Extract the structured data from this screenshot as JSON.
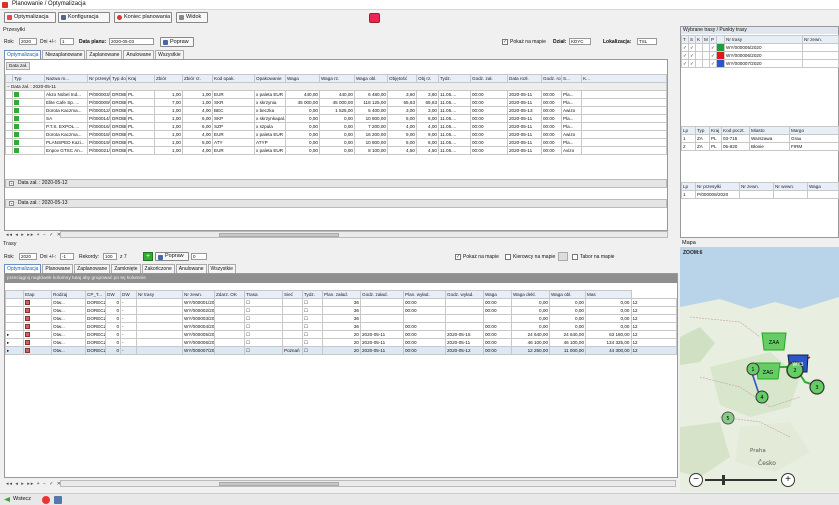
{
  "window": {
    "title": "Planowanie / Optymalizacja"
  },
  "toolbar": {
    "optimization": "Optymalizacja",
    "configuration": "Konfiguracja",
    "end_planning": "Koniec planowania",
    "view": "Widok"
  },
  "przesylki": {
    "title": "Przesyłki",
    "rok_label": "Rok:",
    "rok_value": "2020",
    "dni_label": "Dni +/-:",
    "dni_value": "1",
    "data_planu_label": "Data planu:",
    "data_planu_value": "2020-05-03",
    "popraw": "Popraw",
    "show_on_map": "Pokaż na mapie",
    "dzial_label": "Dział:",
    "dzial_value": "KDYC",
    "lokalizacja_label": "Lokalizacja:",
    "lokalizacja_value": "TSL",
    "tabs": [
      "Optymalizacja",
      "Niezaplanowane",
      "Zaplanowane",
      "Anulowane",
      "Wszystkie"
    ],
    "group_chip": "Data zał.",
    "columns": [
      "Typ",
      "Nazwa m...",
      "Nr przesyłki",
      "Typ doc.",
      "Kraj",
      "Zbiór",
      "Zbiór rz.",
      "Kod opak.",
      "Opakowanie",
      "Waga",
      "Waga rz.",
      "Waga obl.",
      "Objętość",
      "Obj rz.",
      "Tydz.",
      "Godz. zał.",
      "Data rozł.",
      "Godz. rozł.",
      "S...",
      "K..."
    ],
    "groups": [
      "Data zał. : 2020-05-11",
      "Data zał. : 2020-05-12",
      "Data zał. : 2020-05-13"
    ],
    "rows": [
      [
        "Akzo Nobel Ind...",
        "P/000003/2020",
        "DROBN",
        "PL",
        "1,00",
        "1,00",
        "EUR",
        "x paleta EUR",
        "440,00",
        "440,00",
        "6 480,00",
        "3,60",
        "3,60",
        "11.05....",
        "00:00",
        "2020-05-11",
        "00:00",
        "Pla..."
      ],
      [
        "Elite Cafe Sp. ...",
        "P/000009/2020",
        "DROBN",
        "PL",
        "7,00",
        "1,00",
        "SKR",
        "x skrzynia",
        "45 000,00",
        "45 000,00",
        "118 125,00",
        "65,63",
        "65,63",
        "11.05....",
        "00:00",
        "2020-05-11",
        "00:00",
        "Pla..."
      ],
      [
        "Dorota Kaczma...",
        "P/000012/2020",
        "DROBN",
        "PL",
        "1,00",
        "4,00",
        "BEC",
        "x beczka",
        "0,00",
        "1 525,00",
        "5 400,00",
        "3,00",
        "3,00",
        "11.05....",
        "00:00",
        "2020-05-13",
        "00:00",
        "Awizo"
      ],
      [
        "SA",
        "P/000014/2020",
        "DROBN",
        "PL",
        "1,00",
        "6,00",
        "SKP",
        "x skrzynkapal...",
        "0,00",
        "0,00",
        "10 800,00",
        "6,00",
        "6,00",
        "11.05....",
        "00:00",
        "2020-05-11",
        "00:00",
        "Pla..."
      ],
      [
        "P.T.S. EXPOL ...",
        "P/000016/2020",
        "DROBN",
        "PL",
        "1,00",
        "6,00",
        "SZP",
        "x szpula",
        "0,00",
        "0,00",
        "7 200,00",
        "4,00",
        "4,00",
        "11.05....",
        "00:00",
        "2020-05-11",
        "00:00",
        "Pla..."
      ],
      [
        "Dorota Kaczma...",
        "P/000018/2020",
        "DROBN",
        "PL",
        "1,00",
        "4,00",
        "EUR",
        "x paleta EUR",
        "0,00",
        "0,00",
        "16 200,00",
        "9,00",
        "9,00",
        "11.05....",
        "00:00",
        "2020-05-11",
        "00:00",
        "Awizo"
      ],
      [
        "PLANSPED Kazi...",
        "P/000019/2020",
        "DROBN",
        "PL",
        "1,00",
        "5,00",
        "ATY",
        "ATYP",
        "0,00",
        "0,00",
        "10 800,00",
        "6,00",
        "6,00",
        "11.05....",
        "00:00",
        "2020-05-11",
        "00:00",
        "Pla..."
      ],
      [
        "Enpov GTSC An...",
        "P/000021/2020",
        "DROBN",
        "PL",
        "1,00",
        "4,00",
        "EUR",
        "x paleta EUR",
        "0,00",
        "0,00",
        "8 100,00",
        "4,50",
        "4,50",
        "11.05....",
        "00:00",
        "2020-05-11",
        "00:00",
        "Avizo"
      ]
    ]
  },
  "trasy_top": {
    "title": "Wybrane trasy / Punkty trasy",
    "columns": [
      "T",
      "S",
      "K",
      "M",
      "P",
      "",
      "Nr trasy",
      "Nr zewn."
    ],
    "rows": [
      {
        "nr": "WY/000005/2020",
        "color": "#1aa03a"
      },
      {
        "nr": "WY/000006/2020",
        "color": "#e01818"
      },
      {
        "nr": "WY/000007/2020",
        "color": "#2b55c8"
      }
    ],
    "points_columns": [
      "Lp",
      "Typ",
      "Kraj",
      "Kod poczt.",
      "Miasto",
      "Margo"
    ],
    "points": [
      [
        "1",
        "ZA",
        "PL",
        "03-715",
        "Warszawa",
        "Grau"
      ],
      [
        "2",
        "ZA",
        "PL",
        "05-820",
        "Błonie",
        "FIRM"
      ]
    ],
    "lower_columns": [
      "Lp",
      "Nr przesyłki",
      "Nr zewn.",
      "Nr wewn.",
      "Waga"
    ],
    "lower_rows": [
      [
        "1",
        "P/000008/2020"
      ]
    ]
  },
  "trasy": {
    "title": "Trasy",
    "rok_label": "Rok:",
    "rok_value": "2020",
    "dni_label": "Dni +/-:",
    "dni_value": "-1",
    "kolumny_label": "Rekordy:",
    "kolumny_value": "100",
    "kolumny_of": "z 7",
    "popraw": "Popraw",
    "popraw_num": "0",
    "show_on_map": "Pokaż na mapie",
    "kierowcy": "Kierowcy na mapie",
    "tabor": "Tabor na mapie",
    "tabs": [
      "Optymalizacja",
      "Planowane",
      "Zaplanowane",
      "Zamknięte",
      "Zakończone",
      "Anulowane",
      "Wszystkie"
    ],
    "group_hint": "przeciągnij nagłówek kolumny tutaj aby grupować po tej kolumnie",
    "columns": [
      "Etap",
      "Rodzaj",
      "CP_T...",
      "DW",
      "DW",
      "Nr trasy",
      "Nr zewn.",
      "Zdarz. OK",
      "Trasa",
      "Sieć",
      "Tydz.",
      "Plan. załad.",
      "Godz. załad.",
      "Plan. wyład.",
      "Godz. wyład.",
      "Waga",
      "Waga dekl.",
      "Waga obl.",
      "Mas"
    ],
    "rows": [
      [
        "Otw...",
        "DORECZENIE",
        "0",
        "-",
        "WY/000001/2020",
        "36",
        "",
        "00:00",
        "",
        "00:00",
        "0,00",
        "0,00",
        "0,00",
        "12"
      ],
      [
        "Otw...",
        "DORECZENIE",
        "0",
        "-",
        "WY/000002/2020",
        "36",
        "",
        "00:00",
        "",
        "00:00",
        "0,00",
        "0,00",
        "0,00",
        "12"
      ],
      [
        "Otw...",
        "DORECZENIE",
        "0",
        "-",
        "WY/000003/2020",
        "36",
        "",
        "",
        "",
        "",
        "0,00",
        "0,00",
        "0,00",
        "12"
      ],
      [
        "Otw...",
        "DORECZENIE",
        "0",
        "-",
        "WY/000004/2020",
        "36",
        "",
        "00:00",
        "",
        "00:00",
        "0,00",
        "0,00",
        "0,00",
        "12"
      ],
      [
        "Otw...",
        "DORECZENIE",
        "0",
        "-",
        "WY/000005/2020",
        "20",
        "2020-05-11",
        "00:00",
        "2020-05-15",
        "00:00",
        "24 640,00",
        "24 640,00",
        "63 180,00",
        "12"
      ],
      [
        "Otw...",
        "DORECZENIE",
        "0",
        "-",
        "WY/000006/2020",
        "20",
        "2020-05-11",
        "00:00",
        "2020-05-11",
        "00:00",
        "46 100,00",
        "46 100,00",
        "134 325,00",
        "12"
      ],
      [
        "Otw...",
        "DORECZENIE",
        "0",
        "-",
        "WY/000007/2020",
        "20",
        "2020-05-11",
        "00:00",
        "2020-05-12",
        "00:00",
        "12 250,00",
        "11 000,00",
        "44 300,00",
        "12"
      ]
    ],
    "last_trasa": "Poznań"
  },
  "map": {
    "title": "Mapa",
    "zoom_label": "ZOOM:6",
    "labels": [
      "WY3",
      "ZAG",
      "ZAA",
      "Praha",
      "Česko"
    ],
    "nodes": [
      "1",
      "2",
      "3",
      "4",
      "5",
      "6",
      "7"
    ]
  },
  "status": {
    "wstecz": "Wstecz"
  }
}
